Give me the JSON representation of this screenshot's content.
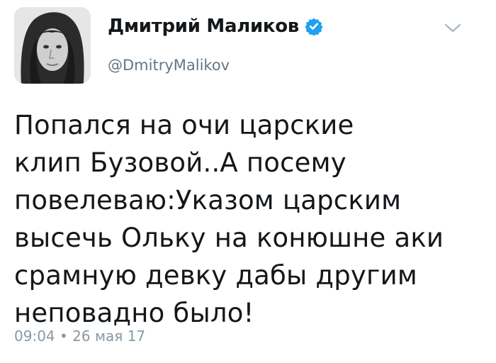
{
  "author": {
    "display_name": "Дмитрий Маликов",
    "handle": "@DmitryMalikov",
    "verified": true,
    "avatar_icon": "user-avatar"
  },
  "tweet": {
    "text": "Попался на очи царские\nклип Бузовой..А посему\nповелеваю:Указом царским\nвысечь Ольку на конюшне аки\nсрамную девку дабы другим\nнеповадно было!",
    "time": "09:04",
    "separator": "•",
    "date": "26 мая 17"
  },
  "menu": {
    "icon": "chevron-down-icon"
  },
  "colors": {
    "verified": "#1da1f2",
    "secondary_text": "#657786",
    "meta_text": "#8899a6",
    "caret": "#aab8c2"
  }
}
